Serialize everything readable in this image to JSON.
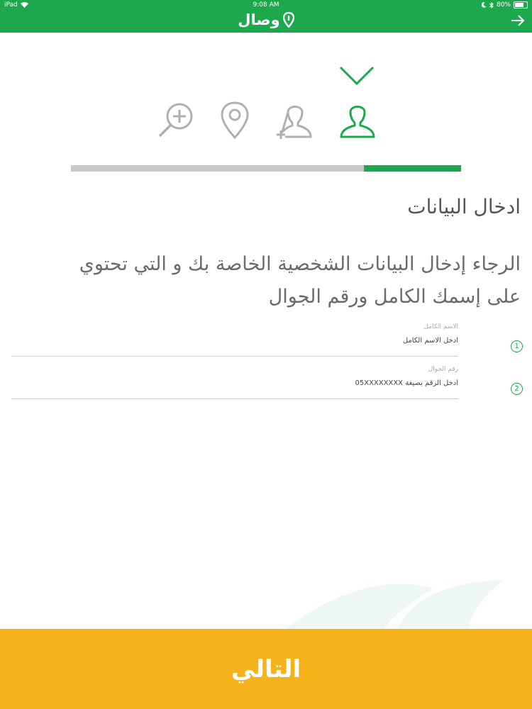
{
  "status_bar": {
    "device": "iPad",
    "time": "9:08 AM",
    "battery": "80%"
  },
  "header": {
    "logo_text": "وصال",
    "icons": [
      "pin-logo-icon",
      "arrow-right-icon"
    ],
    "accent": "#1ea84e"
  },
  "steps": {
    "completed": [
      "check-icon"
    ],
    "icons": [
      "user-icon",
      "add-user-icon",
      "location-icon",
      "search-plus-icon"
    ],
    "active_color": "#1ea84e",
    "inactive_color": "#b0b0b0"
  },
  "progress": {
    "value": 0.25
  },
  "page": {
    "title": "ادخال البيانات",
    "description": "الرجاء إدخال البيانات الشخصية الخاصة بك و التي تحتوي على إسمك الكامل ورقم الجوال"
  },
  "form": {
    "fields": [
      {
        "number": "1",
        "label": "الاسم الكامل",
        "placeholder": "ادخل الاسم الكامل",
        "value": ""
      },
      {
        "number": "2",
        "label": "رقم الجوال",
        "placeholder": "أدخل الرقم بصيغة 05XXXXXXXX",
        "value": ""
      }
    ]
  },
  "footer": {
    "next_label": "التالي",
    "color": "#f5b21a"
  }
}
